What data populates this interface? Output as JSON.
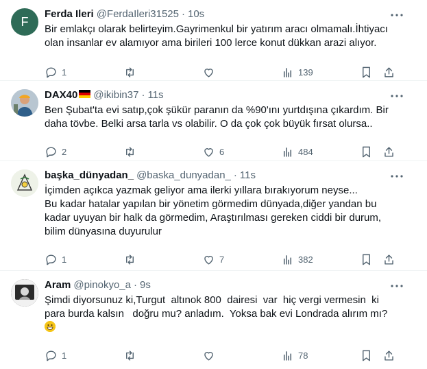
{
  "tweets": [
    {
      "name": "Ferda Ileri",
      "handle": "@FerdaIleri31525",
      "dot": "·",
      "time": "10s",
      "avatar_letter": "F",
      "avatar_color": "#2e6b57",
      "text": "Bir emlakçı olarak belirteyim.Gayrimenkul bir yatırım aracı olmamalı.İhtiyacı olan insanlar ev alamıyor ama birileri 100 lerce konut dükkan arazi alıyor.",
      "replies": "1",
      "reposts": "",
      "likes": "",
      "views": "139"
    },
    {
      "name": "DAX40",
      "handle": "@ikibin37",
      "dot": "·",
      "time": "11s",
      "flag": "germany-flag",
      "text": "Ben Şubat'ta evi satıp,çok şükür paranın da %90'ını yurtdışına çıkardım. Bir daha tövbe. Belki arsa tarla vs olabilir. O da çok çok büyük fırsat olursa..",
      "replies": "2",
      "reposts": "",
      "likes": "6",
      "views": "484"
    },
    {
      "name": "başka_dünyadan_",
      "handle": "@baska_dunyadan_",
      "dot": "·",
      "time": "11s",
      "text": "İçimden açıkca yazmak geliyor ama ilerki yıllara bırakıyorum neyse...\nBu kadar hatalar yapılan bir yönetim görmedim dünyada,diğer yandan bu kadar uyuyan bir halk da görmedim, Araştırılması gereken ciddi bir durum, bilim dünyasına duyurulur",
      "replies": "1",
      "reposts": "",
      "likes": "7",
      "views": "382"
    },
    {
      "name": "Aram",
      "handle": "@pinokyo_a",
      "dot": "·",
      "time": "9s",
      "text": "Şimdi diyorsunuz ki,Turgut  altınok 800  dairesi  var  hiç vergi vermesin  ki para burda kalsın   doğru mu? anladım.  Yoksa bak evi Londrada alırım mı?",
      "emoji": "grinning-face-emoji",
      "replies": "1",
      "reposts": "",
      "likes": "",
      "views": "78"
    }
  ],
  "colors": {
    "text": "#0f1419",
    "secondary": "#536471",
    "divider": "#eff3f4"
  }
}
